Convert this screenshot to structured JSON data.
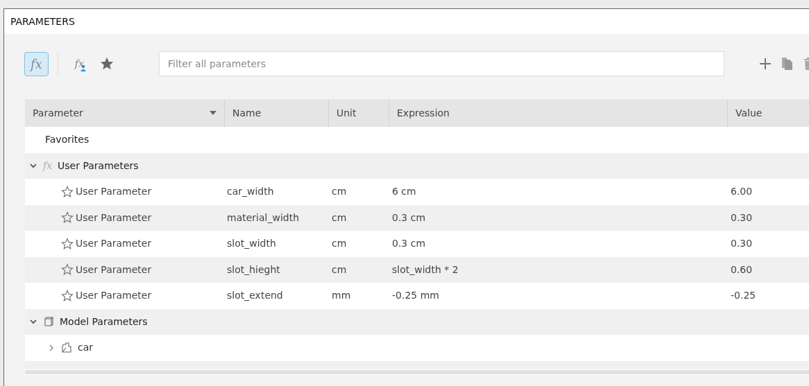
{
  "window": {
    "title": "PARAMETERS"
  },
  "toolbar": {
    "filters": [
      {
        "kind": "all",
        "glyph": "fx",
        "selected": true
      },
      {
        "kind": "user",
        "glyph": "fx",
        "selected": false
      },
      {
        "kind": "favorites",
        "selected": false
      }
    ],
    "search": {
      "placeholder": "Filter all parameters"
    }
  },
  "table": {
    "columns": [
      "Parameter",
      "Name",
      "Unit",
      "Expression",
      "Value"
    ],
    "groups": [
      {
        "kind": "favorites",
        "label": "Favorites"
      },
      {
        "kind": "user",
        "label": "User Parameters",
        "glyph": "fx",
        "expanded": true,
        "children": [
          {
            "parameter": "User Parameter",
            "name": "car_width",
            "unit": "cm",
            "expression": "6 cm",
            "value": "6.00"
          },
          {
            "parameter": "User Parameter",
            "name": "material_width",
            "unit": "cm",
            "expression": "0.3 cm",
            "value": "0.30"
          },
          {
            "parameter": "User Parameter",
            "name": "slot_width",
            "unit": "cm",
            "expression": "0.3 cm",
            "value": "0.30"
          },
          {
            "parameter": "User Parameter",
            "name": "slot_hieght",
            "unit": "cm",
            "expression": "slot_width * 2",
            "value": "0.60"
          },
          {
            "parameter": "User Parameter",
            "name": "slot_extend",
            "unit": "mm",
            "expression": "-0.25 mm",
            "value": "-0.25"
          }
        ]
      },
      {
        "kind": "model",
        "label": "Model Parameters",
        "expanded": true,
        "children": [
          {
            "label": "car",
            "expanded": false
          }
        ]
      }
    ]
  }
}
